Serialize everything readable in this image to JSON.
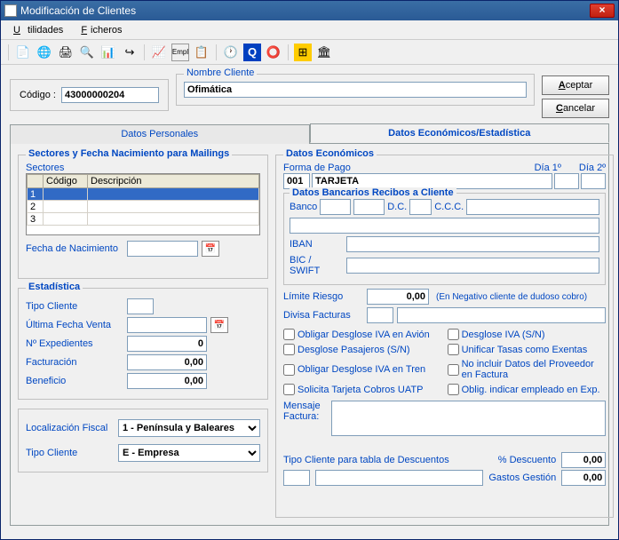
{
  "window": {
    "title": "Modificación de Clientes"
  },
  "menu": {
    "utilidades": "Utilidades",
    "ficheros": "Ficheros"
  },
  "buttons": {
    "aceptar": "Aceptar",
    "cancelar": "Cancelar"
  },
  "codigo": {
    "label": "Código :",
    "value": "43000000204"
  },
  "nombre": {
    "legend": "Nombre Cliente",
    "value": "Ofimática"
  },
  "tabs": {
    "personales": "Datos Personales",
    "economicos": "Datos Económicos/Estadística"
  },
  "sectores": {
    "legend": "Sectores y Fecha Nacimiento para Mailings",
    "sub": "Sectores",
    "col_codigo": "Código",
    "col_desc": "Descripción",
    "rows": [
      "1",
      "2",
      "3"
    ],
    "fecha_label": "Fecha de Nacimiento",
    "fecha_value": ""
  },
  "estadistica": {
    "legend": "Estadística",
    "tipo_cliente": "Tipo Cliente",
    "tipo_cliente_val": "",
    "ultima_fecha": "Última Fecha Venta",
    "ultima_fecha_val": "",
    "n_exp": "Nº Expedientes",
    "n_exp_val": "0",
    "facturacion": "Facturación",
    "facturacion_val": "0,00",
    "beneficio": "Beneficio",
    "beneficio_val": "0,00"
  },
  "fiscal": {
    "loc_label": "Localización Fiscal",
    "loc_val": "1 - Península y Baleares",
    "tipo_label": "Tipo Cliente",
    "tipo_val": "E - Empresa"
  },
  "econ": {
    "legend": "Datos Económicos",
    "forma_pago": "Forma de Pago",
    "dia1": "Día 1º",
    "dia2": "Día 2º",
    "fp_code": "001",
    "fp_desc": "TARJETA",
    "bank_legend": "Datos Bancarios Recibos a Cliente",
    "banco": "Banco",
    "dc": "D.C.",
    "ccc": "C.C.C.",
    "iban": "IBAN",
    "bic": "BIC / SWIFT",
    "limite": "Límite Riesgo",
    "limite_val": "0,00",
    "limite_note": "(En Negativo cliente de dudoso cobro)",
    "divisa": "Divisa Facturas",
    "chk1": "Obligar Desglose IVA en Avión",
    "chk2": "Desglose Pasajeros (S/N)",
    "chk3": "Obligar Desglose IVA en Tren",
    "chk4": "Solicita Tarjeta Cobros UATP",
    "chk5": "Desglose IVA (S/N)",
    "chk6": "Unificar Tasas como Exentas",
    "chk7": "No incluir Datos del Proveedor en Factura",
    "chk8": "Oblig. indicar empleado en Exp.",
    "mensaje": "Mensaje Factura:",
    "tipo_desc": "Tipo Cliente para tabla de Descuentos",
    "pct_desc": "% Descuento",
    "pct_desc_val": "0,00",
    "gastos": "Gastos Gestión",
    "gastos_val": "0,00"
  }
}
